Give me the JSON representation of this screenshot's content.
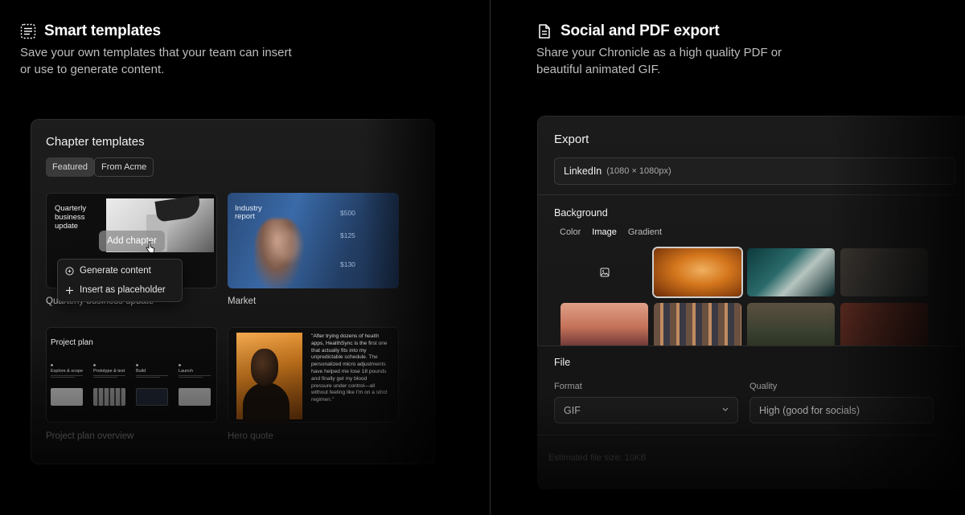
{
  "left": {
    "heading": "Smart templates",
    "description_line1": "Save your own templates that your team can insert",
    "description_line2": "or use to generate content.",
    "card": {
      "title": "Chapter templates",
      "chips": [
        "Featured",
        "From Acme"
      ],
      "thumbs": {
        "quarterly": {
          "text_line1": "Quarterly",
          "text_line2": "business",
          "text_line3": "update",
          "label": "Quarterly business update"
        },
        "market": {
          "text_line1": "Industry",
          "text_line2": "report",
          "label": "Market",
          "numbers": [
            "$500",
            "$125",
            "$130"
          ]
        },
        "project": {
          "title": "Project plan",
          "label": "Project plan overview",
          "columns": [
            "Explore & scope",
            "Prototype & test",
            "Build",
            "Launch"
          ]
        },
        "hero": {
          "label": "Hero quote",
          "quote": "\"After trying dozens of health apps, HealthSync is the first one that actually fits into my unpredictable schedule. The personalized micro adjustments have helped me lose 18 pounds and finally get my blood pressure under control—all without feeling like I'm on a strict regimen.\""
        }
      },
      "add_chapter": "Add chapter",
      "menu": {
        "generate": "Generate content",
        "insert": "Insert as placeholder"
      }
    }
  },
  "right": {
    "heading": "Social and PDF export",
    "description_line1": "Share your Chronicle as a high quality PDF or",
    "description_line2": "beautiful animated GIF.",
    "card": {
      "title": "Export",
      "preset_main": "LinkedIn",
      "preset_sub": "(1080 × 1080px)",
      "background_title": "Background",
      "bg_tabs": [
        "Color",
        "Image",
        "Gradient"
      ],
      "active_bg_tab": "Image",
      "file_title": "File",
      "format_label": "Format",
      "format_value": "GIF",
      "quality_label": "Quality",
      "quality_value": "High (good for socials)",
      "estimated": "Estimated file size: 10KB"
    }
  },
  "colors": {
    "background": "#000000",
    "accent_orange": "#d9802a",
    "market_blue": "#3a6aa8"
  }
}
